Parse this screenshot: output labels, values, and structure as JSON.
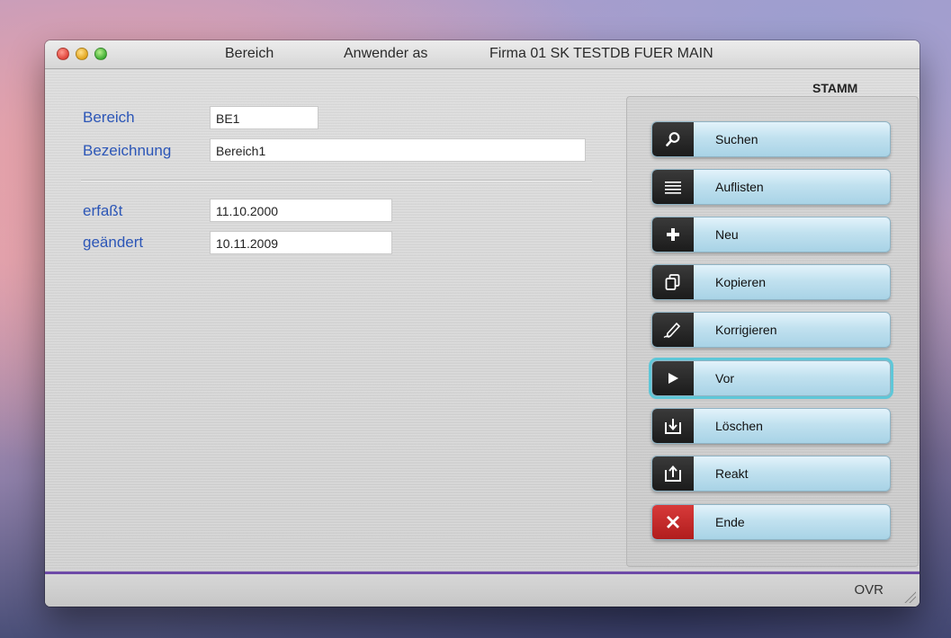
{
  "window": {
    "title_segments": [
      "Bereich",
      "Anwender as",
      "Firma 01 SK TESTDB FUER MAIN"
    ]
  },
  "mode_label": "STAMM",
  "form": {
    "bereich": {
      "label": "Bereich",
      "value": "BE1"
    },
    "bezeichnung": {
      "label": "Bezeichnung",
      "value": "Bereich1"
    },
    "erfasst": {
      "label": "erfaßt",
      "value": "11.10.2000"
    },
    "geaendert": {
      "label": "geändert",
      "value": "10.11.2009"
    }
  },
  "buttons": [
    {
      "label": "Suchen",
      "icon": "search-icon"
    },
    {
      "label": "Auflisten",
      "icon": "list-icon"
    },
    {
      "label": "Neu",
      "icon": "plus-icon"
    },
    {
      "label": "Kopieren",
      "icon": "copy-icon"
    },
    {
      "label": "Korrigieren",
      "icon": "pencil-icon"
    },
    {
      "label": "Vor",
      "icon": "play-icon",
      "selected": true
    },
    {
      "label": "Löschen",
      "icon": "download-tray-icon"
    },
    {
      "label": "Reakt",
      "icon": "upload-tray-icon"
    },
    {
      "label": "Ende",
      "icon": "close-x-icon",
      "accent": "#c9262b"
    }
  ],
  "status": {
    "mode": "OVR"
  },
  "colors": {
    "label_blue": "#2c56b7",
    "status_line": "#6e4aa8",
    "selection": "#5ec7d8"
  }
}
